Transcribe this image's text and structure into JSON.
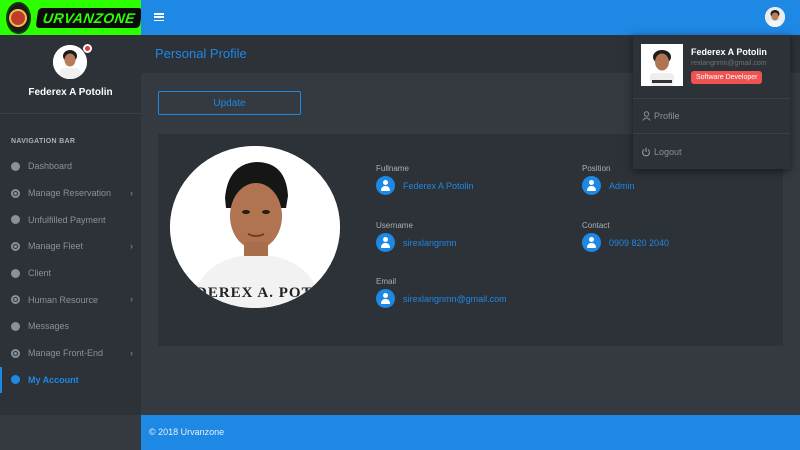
{
  "brand": {
    "logo_text": "URVANZONE"
  },
  "user": {
    "name": "Federex A Potolin",
    "email": "rexlangnmn@gmail.com",
    "role_badge": "Software Developer",
    "photo_caption": "EDEREX A. POTO"
  },
  "sidebar": {
    "nav_title": "NAVIGATION BAR",
    "items": [
      {
        "label": "Dashboard",
        "icon": "circle-icon",
        "chevron": false
      },
      {
        "label": "Manage Reservation",
        "icon": "ring-icon",
        "chevron": true
      },
      {
        "label": "Unfulfilled Payment",
        "icon": "circle-icon",
        "chevron": false
      },
      {
        "label": "Manage Fleet",
        "icon": "ring-icon",
        "chevron": true
      },
      {
        "label": "Client",
        "icon": "circle-icon",
        "chevron": false
      },
      {
        "label": "Human Resource",
        "icon": "ring-icon",
        "chevron": true
      },
      {
        "label": "Messages",
        "icon": "circle-icon",
        "chevron": false
      },
      {
        "label": "Manage Front-End",
        "icon": "ring-icon",
        "chevron": true
      },
      {
        "label": "My Account",
        "icon": "circle-icon",
        "chevron": false,
        "active": true
      }
    ],
    "chevron": "›"
  },
  "page": {
    "title": "Personal Profile",
    "update_label": "Update"
  },
  "profile": {
    "fullname": {
      "label": "Fullname",
      "value": "Federex A Potolin"
    },
    "position": {
      "label": "Position",
      "value": "Admin"
    },
    "username": {
      "label": "Username",
      "value": "sirexlangnmn"
    },
    "contact": {
      "label": "Contact",
      "value": "0909 820 2040"
    },
    "email": {
      "label": "Email",
      "value": "sirexlangnmn@gmail.com"
    }
  },
  "dropdown": {
    "profile_label": "Profile",
    "logout_label": "Logout"
  },
  "footer": {
    "text": "© 2018 Urvanzone"
  },
  "colors": {
    "accent": "#1e88e5",
    "logo_bg": "#2bff00",
    "badge": "#ef5350"
  }
}
